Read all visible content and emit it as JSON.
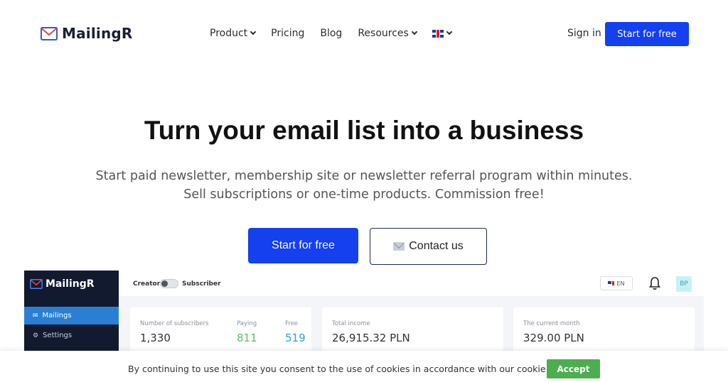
{
  "header": {
    "brand": "MailingR",
    "menu": [
      {
        "label": "Product",
        "has_dropdown": true
      },
      {
        "label": "Pricing",
        "has_dropdown": false
      },
      {
        "label": "Blog",
        "has_dropdown": false
      },
      {
        "label": "Resources",
        "has_dropdown": true
      }
    ],
    "language_icon": "uk-flag-icon",
    "signin": "Sign in",
    "cta": "Start for free"
  },
  "hero": {
    "title": "Turn your email list into a business",
    "subtitle_line1": "Start paid newsletter, membership site or newsletter referral program within minutes.",
    "subtitle_line2": "Sell subscriptions or one-time products. Commission free!",
    "primary_button": "Start for free",
    "secondary_button": "Contact us",
    "secondary_icon": "envelope-icon"
  },
  "app_preview": {
    "brand": "MailingR",
    "sidebar": [
      {
        "label": "Mailings",
        "icon": "mail-icon",
        "active": true
      },
      {
        "label": "Settings",
        "icon": "gear-icon",
        "active": false
      }
    ],
    "toggle_left": "Creator",
    "toggle_right": "Subscriber",
    "lang": "EN",
    "avatar": "BP",
    "cards": {
      "subscribers": {
        "label": "Number of subscribers",
        "value": "1,330",
        "paying_label": "Paying",
        "paying_value": "811",
        "free_label": "Free",
        "free_value": "519"
      },
      "income": {
        "label": "Total income",
        "value": "26,915.32 PLN"
      },
      "month": {
        "label": "The current month",
        "value": "329.00 PLN"
      }
    }
  },
  "cookie": {
    "text": "By continuing to use this site you consent to the use of cookies in accordance with our",
    "link": "cookie policy.",
    "accept": "Accept"
  },
  "colors": {
    "accent": "#1440f0",
    "sidebar": "#111a2e",
    "accept": "#4cae4f"
  }
}
